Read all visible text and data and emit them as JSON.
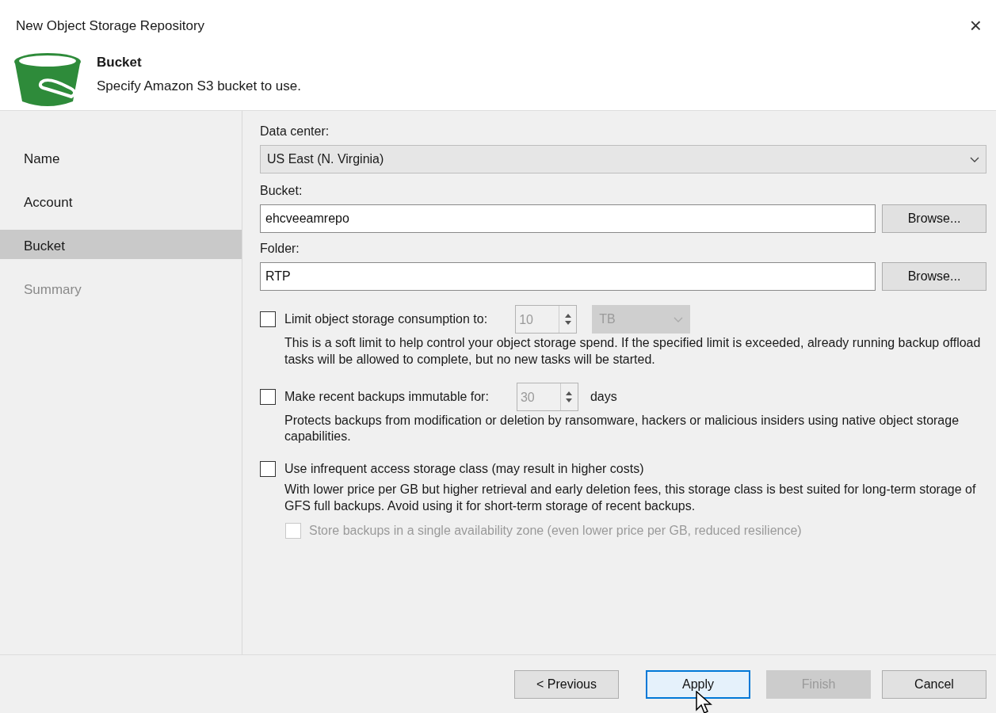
{
  "window": {
    "title": "New Object Storage Repository",
    "close": "×"
  },
  "header": {
    "title": "Bucket",
    "subtitle": "Specify Amazon S3 bucket to use."
  },
  "steps": [
    {
      "label": "Name",
      "selected": false,
      "disabled": false
    },
    {
      "label": "Account",
      "selected": false,
      "disabled": false
    },
    {
      "label": "Bucket",
      "selected": true,
      "disabled": false
    },
    {
      "label": "Summary",
      "selected": false,
      "disabled": true
    }
  ],
  "data_center": {
    "label": "Data center:",
    "value": "US East (N. Virginia)"
  },
  "bucket": {
    "label": "Bucket:",
    "value": "ehcveeamrepo",
    "button": "Browse..."
  },
  "folder": {
    "label": "Folder:",
    "value": "RTP",
    "button": "Browse..."
  },
  "options": [
    {
      "kind": "spinner-unit",
      "label": "Limit object storage consumption to:",
      "checked": false,
      "value": "10",
      "unit": "TB",
      "description": "This is a soft limit to help control your object storage spend. If the specified limit is exceeded, already running backup offload tasks will be allowed to complete, but no new tasks will be started."
    },
    {
      "kind": "spinner-suffix",
      "label": "Make recent backups immutable for:",
      "checked": false,
      "value": "30",
      "suffix": "days",
      "description": "Protects backups from modification or deletion by ransomware, hackers or malicious insiders using native object storage capabilities."
    },
    {
      "kind": "plain",
      "label": "Use infrequent access storage class (may result in higher costs)",
      "checked": false,
      "description": "With lower price per GB but higher retrieval and early deletion fees, this storage class is best suited for long-term storage of GFS full backups. Avoid using it for short-term storage of recent backups.",
      "sub_option": {
        "label": "Store backups in a single availability zone (even lower price per GB, reduced resilience)",
        "checked": false,
        "disabled": true
      }
    }
  ],
  "buttons": [
    {
      "label": "< Previous",
      "disabled": false,
      "focused": false
    },
    {
      "label": "Apply",
      "disabled": false,
      "focused": true
    },
    {
      "label": "Finish",
      "disabled": true,
      "focused": false
    },
    {
      "label": "Cancel",
      "disabled": false,
      "focused": false
    }
  ]
}
